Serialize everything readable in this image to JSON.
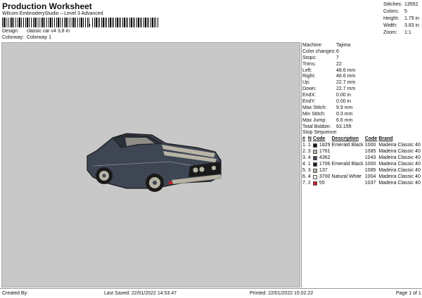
{
  "header": {
    "title": "Production Worksheet",
    "subtitle": "Wilcom EmbroideryStudio – Level 3 Advanced",
    "barcode_mark": ",",
    "design_label": "Design:",
    "design_value": "classic car v4 3,8 in",
    "colorway_label": "Colorway:",
    "colorway_value": "Colorway 1"
  },
  "stats": [
    {
      "label": "Stitches:",
      "value": "13552"
    },
    {
      "label": "Colors:",
      "value": "5"
    },
    {
      "label": "Height:",
      "value": "1.79 in"
    },
    {
      "label": "Width:",
      "value": "3.83 in"
    },
    {
      "label": "Zoom:",
      "value": "1:1"
    }
  ],
  "machine_info": [
    {
      "label": "Machine:",
      "value": "Tajima"
    },
    {
      "label": "Color changes:",
      "value": "6"
    },
    {
      "label": "Stops:",
      "value": "7"
    },
    {
      "label": "Trims:",
      "value": "22"
    },
    {
      "label": "Left:",
      "value": "48.6 mm"
    },
    {
      "label": "Right:",
      "value": "48.6 mm"
    },
    {
      "label": "Up:",
      "value": "22.7 mm"
    },
    {
      "label": "Down:",
      "value": "22.7 mm"
    },
    {
      "label": "EndX:",
      "value": "0.00 in"
    },
    {
      "label": "EndY:",
      "value": "0.00 in"
    },
    {
      "label": "Max Stitch:",
      "value": "9.9 mm"
    },
    {
      "label": "Min Stitch:",
      "value": "0.3 mm"
    },
    {
      "label": "Max Jump:",
      "value": "6.6 mm"
    },
    {
      "label": "Total Bobbin:",
      "value": "63.15ft"
    }
  ],
  "stop_sequence": {
    "title": "Stop Sequence:",
    "headers": [
      "#",
      "N",
      "Code",
      "Description",
      "Code",
      "Brand"
    ],
    "rows": [
      {
        "num": "1.",
        "n": "1",
        "swatch": "#1a1a1a",
        "code": "1829",
        "desc": "Emerald Black",
        "code2": "1000",
        "brand": "Madeira Classic 40"
      },
      {
        "num": "2.",
        "n": "3",
        "swatch": "#b8b4a6",
        "code": "1761",
        "desc": "",
        "code2": "1085",
        "brand": "Madeira Classic 40"
      },
      {
        "num": "3.",
        "n": "4",
        "swatch": "#3e4654",
        "code": "4362",
        "desc": "",
        "code2": "1043",
        "brand": "Madeira Classic 40"
      },
      {
        "num": "4.",
        "n": "1",
        "swatch": "#1a1a1a",
        "code": "1706",
        "desc": "Emerald Black",
        "code2": "1000",
        "brand": "Madeira Classic 40"
      },
      {
        "num": "5.",
        "n": "3",
        "swatch": "#b8b4a6",
        "code": "137",
        "desc": "",
        "code2": "1085",
        "brand": "Madeira Classic 40"
      },
      {
        "num": "6.",
        "n": "4",
        "swatch": "#f4f4f0",
        "code": "3700",
        "desc": "Natural White",
        "code2": "1004",
        "brand": "Madeira Classic 40"
      },
      {
        "num": "7.",
        "n": "2",
        "swatch": "#cc1f2a",
        "code": "55",
        "desc": "",
        "code2": "1037",
        "brand": "Madeira Classic 40"
      }
    ]
  },
  "footer": {
    "created_by": "Created By:",
    "last_saved": "Last Saved: 22/01/2022 14.53.47",
    "printed": "Printed: 22/01/2022 15.02.22",
    "page": "Page 1 of 1"
  },
  "colors": {
    "canvas_bg": "#c8c8c8",
    "car_body": "#3e4654",
    "stripe": "#b8b4a6"
  }
}
